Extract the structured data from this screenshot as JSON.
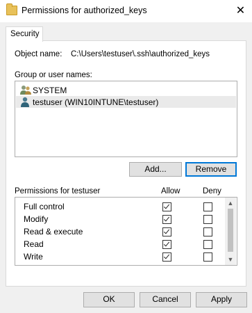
{
  "window": {
    "title": "Permissions for authorized_keys",
    "close_glyph": "✕"
  },
  "tabs": [
    {
      "label": "Security",
      "active": true
    }
  ],
  "object": {
    "label": "Object name:",
    "value": "C:\\Users\\testuser\\.ssh\\authorized_keys"
  },
  "groups": {
    "label": "Group or user names:",
    "items": [
      {
        "label": "SYSTEM",
        "icon": "users-group-icon",
        "selected": false
      },
      {
        "label": "testuser (WIN10INTUNE\\testuser)",
        "icon": "user-icon",
        "selected": true
      }
    ]
  },
  "group_buttons": {
    "add": "Add...",
    "remove": "Remove"
  },
  "permissions": {
    "label": "Permissions for testuser",
    "allow_header": "Allow",
    "deny_header": "Deny",
    "rows": [
      {
        "name": "Full control",
        "allow": true,
        "deny": false
      },
      {
        "name": "Modify",
        "allow": true,
        "deny": false
      },
      {
        "name": "Read & execute",
        "allow": true,
        "deny": false
      },
      {
        "name": "Read",
        "allow": true,
        "deny": false
      },
      {
        "name": "Write",
        "allow": true,
        "deny": false
      }
    ],
    "scroll_up_glyph": "▲",
    "scroll_down_glyph": "▼"
  },
  "dialog_buttons": {
    "ok": "OK",
    "cancel": "Cancel",
    "apply": "Apply"
  },
  "colors": {
    "accent": "#0078d7",
    "selection": "#eaeaea"
  }
}
